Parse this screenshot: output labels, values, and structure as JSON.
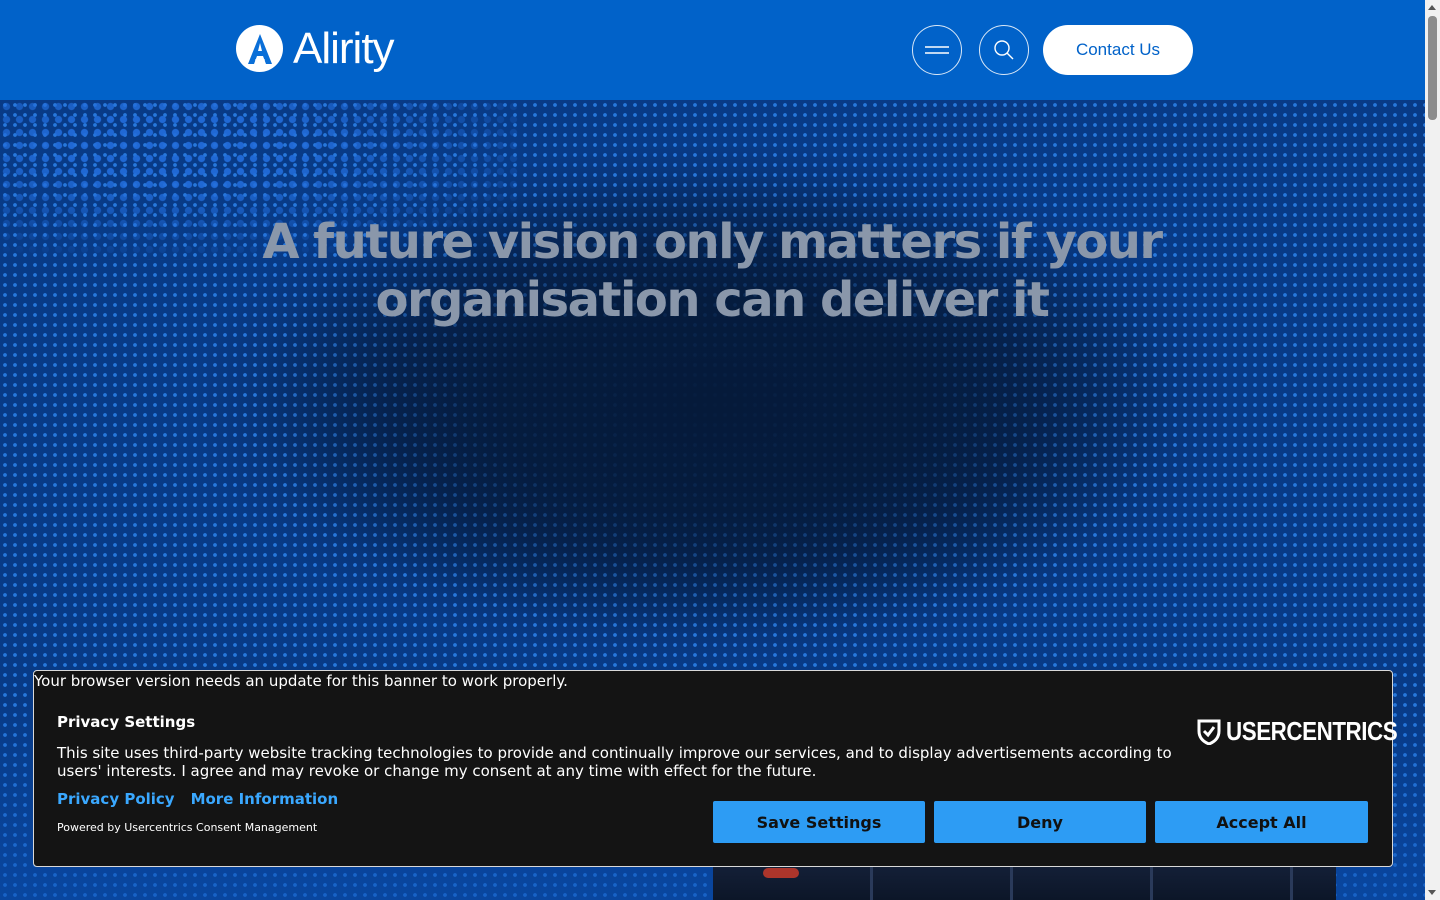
{
  "header": {
    "logo_text": "Alirity",
    "contact_label": "Contact Us",
    "menu_icon": "hamburger-icon",
    "search_icon": "search-icon",
    "brand_color": "#0162C9"
  },
  "hero": {
    "title": "A future vision only matters if your organisation can deliver it"
  },
  "consent": {
    "browser_warning": "Your browser version needs an update for this banner to work properly.",
    "title": "Privacy Settings",
    "text": "This site uses third-party website tracking technologies to provide and continually improve our services, and to display advertisements according to users' interests. I agree and may revoke or change my consent at any time with effect for the future.",
    "privacy_policy": "Privacy Policy",
    "more_information": "More Information",
    "powered_by": "Powered by Usercentrics Consent Management",
    "brand": "USERCENTRICS",
    "save_settings": "Save Settings",
    "deny": "Deny",
    "accept_all": "Accept All",
    "button_color": "#2D9CF4",
    "link_color": "#3AA8FF"
  }
}
